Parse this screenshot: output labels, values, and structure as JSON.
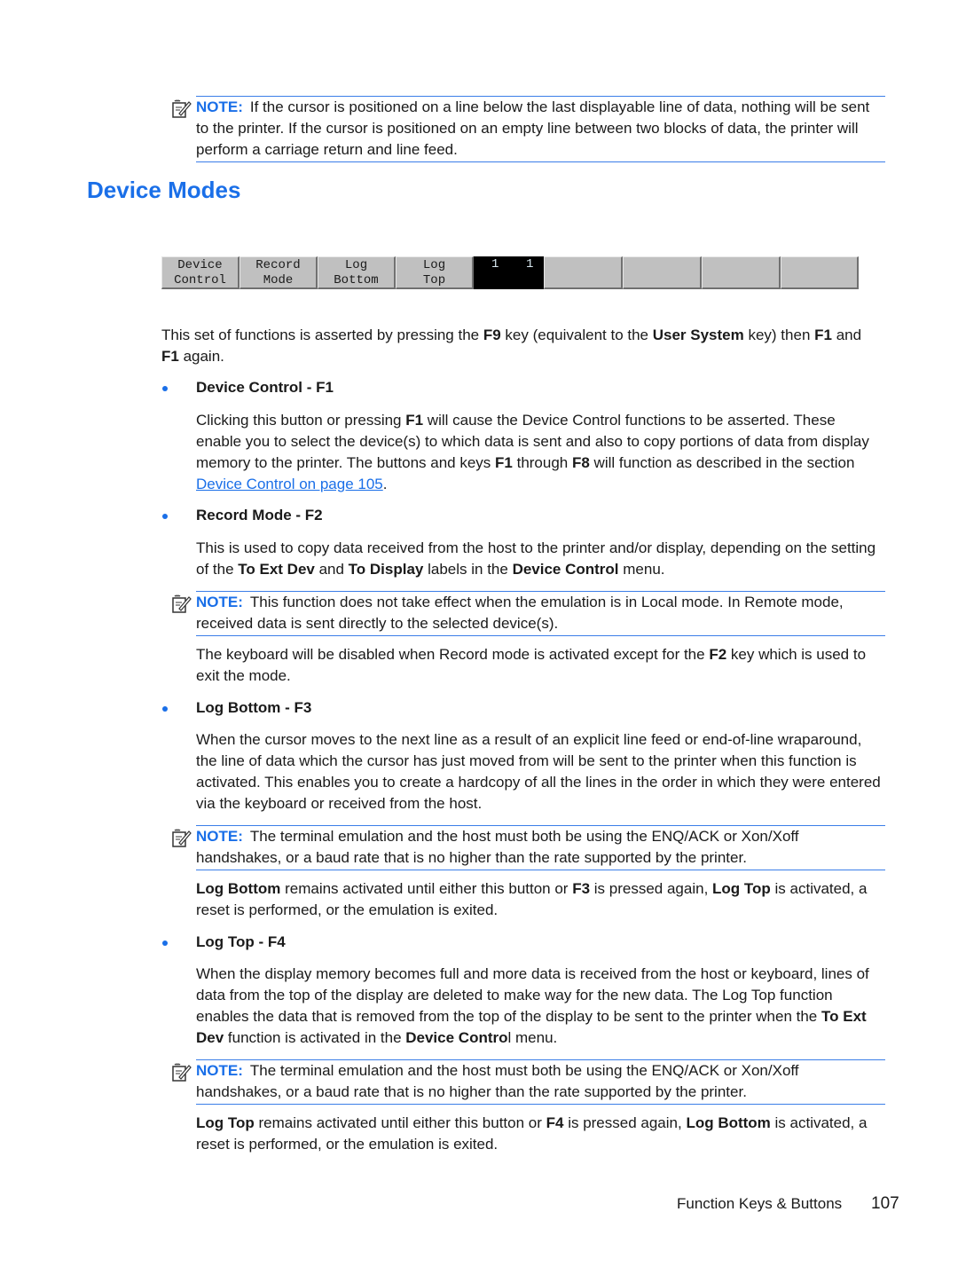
{
  "notes": [
    {
      "label": "NOTE:",
      "text": "If the cursor is positioned on a line below the last displayable line of data, nothing will be sent to the printer. If the cursor is positioned on an empty line between two blocks of data, the printer will perform a carriage return and line feed."
    },
    {
      "label": "NOTE:",
      "text": "This function does not take effect when the emulation is in Local mode. In Remote mode, received data is sent directly to the selected device(s)."
    },
    {
      "label": "NOTE:",
      "text": "The terminal emulation and the host must both be using the ENQ/ACK or Xon/Xoff handshakes, or a baud rate that is no higher than the rate supported by the printer."
    },
    {
      "label": "NOTE:",
      "text": "The terminal emulation and the host must both be using the ENQ/ACK or Xon/Xoff handshakes, or a baud rate that is no higher than the rate supported by the printer."
    }
  ],
  "heading": "Device Modes",
  "function_keys": [
    {
      "line1": "Device",
      "line2": "Control"
    },
    {
      "line1": "Record",
      "line2": "Mode"
    },
    {
      "line1": "Log",
      "line2": "Bottom"
    },
    {
      "line1": "Log",
      "line2": "Top"
    }
  ],
  "status_box": {
    "left": "1",
    "right": "1"
  },
  "empty_keys_count": 4,
  "intro": {
    "t1": "This set of functions is asserted by pressing the ",
    "b1": "F9",
    "t2": " key (equivalent to the ",
    "b2": "User System",
    "t3": " key) then ",
    "b3": "F1",
    "t4": " and ",
    "b4": "F1",
    "t5": " again."
  },
  "sections": {
    "device_control": {
      "title": "Device Control - F1",
      "p1": {
        "t1": "Clicking this button or pressing ",
        "b1": "F1",
        "t2": " will cause the Device Control functions to be asserted. These enable you to select the device(s) to which data is sent and also to copy portions of data from display memory to the printer. The buttons and keys ",
        "b2": "F1",
        "t3": " through ",
        "b3": "F8",
        "t4": " will function as described in the section ",
        "link": "Device Control on page 105",
        "t5": "."
      }
    },
    "record_mode": {
      "title": "Record Mode - F2",
      "p1": {
        "t1": "This is used to copy data received from the host to the printer and/or display, depending on the setting of the ",
        "b1": "To Ext Dev",
        "t2": " and ",
        "b2": "To Display",
        "t3": " labels in the ",
        "b3": "Device Control",
        "t4": " menu."
      },
      "p2": {
        "t1": "The keyboard will be disabled when Record mode is activated except for the ",
        "b1": "F2",
        "t2": " key which is used to exit the mode."
      }
    },
    "log_bottom": {
      "title": "Log Bottom - F3",
      "p1": "When the cursor moves to the next line as a result of an explicit line feed or end-of-line wraparound, the line of data which the cursor has just moved from will be sent to the printer when this function is activated. This enables you to create a hardcopy of all the lines in the order in which they were entered via the keyboard or received from the host.",
      "p2": {
        "b1": "Log Bottom",
        "t1": " remains activated until either this button or ",
        "b2": "F3",
        "t2": " is pressed again, ",
        "b3": "Log Top",
        "t3": " is activated, a reset is performed, or the emulation is exited."
      }
    },
    "log_top": {
      "title": "Log Top - F4",
      "p1": {
        "t1": "When the display memory becomes full and more data is received from the host or keyboard, lines of data from the top of the display are deleted to make way for the new data. The Log Top function enables the data that is removed from the top of the display to be sent to the printer when the ",
        "b1": "To Ext Dev",
        "t2": " function is activated in the ",
        "b2": "Device Contro",
        "t3": "l menu."
      },
      "p2": {
        "b1": "Log Top",
        "t1": " remains activated until either this button or ",
        "b2": "F4",
        "t2": " is pressed again, ",
        "b3": "Log Bottom",
        "t3": " is activated, a reset is performed, or the emulation is exited."
      }
    }
  },
  "footer": {
    "section": "Function Keys & Buttons",
    "page_number": "107"
  },
  "colors": {
    "accent": "#1a6fe8",
    "rule": "#3b7ee8",
    "key_face": "#c0c0c0",
    "status_bg": "#000000"
  }
}
